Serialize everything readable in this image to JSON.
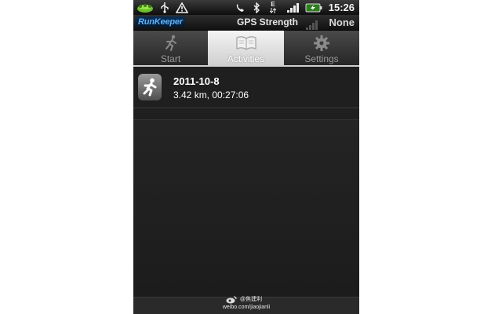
{
  "status_bar": {
    "time": "15:26",
    "network_label": "E"
  },
  "header": {
    "logo_text": "RunKeeper",
    "gps_label": "GPS Strength",
    "gps_value": "None"
  },
  "tabs": [
    {
      "label": "Start",
      "icon": "runner-icon",
      "active": false
    },
    {
      "label": "Activities",
      "icon": "book-icon",
      "active": true
    },
    {
      "label": "Settings",
      "icon": "gear-icon",
      "active": false
    }
  ],
  "activities": [
    {
      "date": "2011-10-8",
      "summary": "3.42 km, 00:27:06",
      "icon": "running-man-icon"
    }
  ],
  "watermark": {
    "name": "@焦建利",
    "url": "weibo.com/jiaojianli"
  },
  "colors": {
    "background": "#222222",
    "active_tab": "#e6e6e6",
    "logo_blue": "#5fb4ff"
  }
}
